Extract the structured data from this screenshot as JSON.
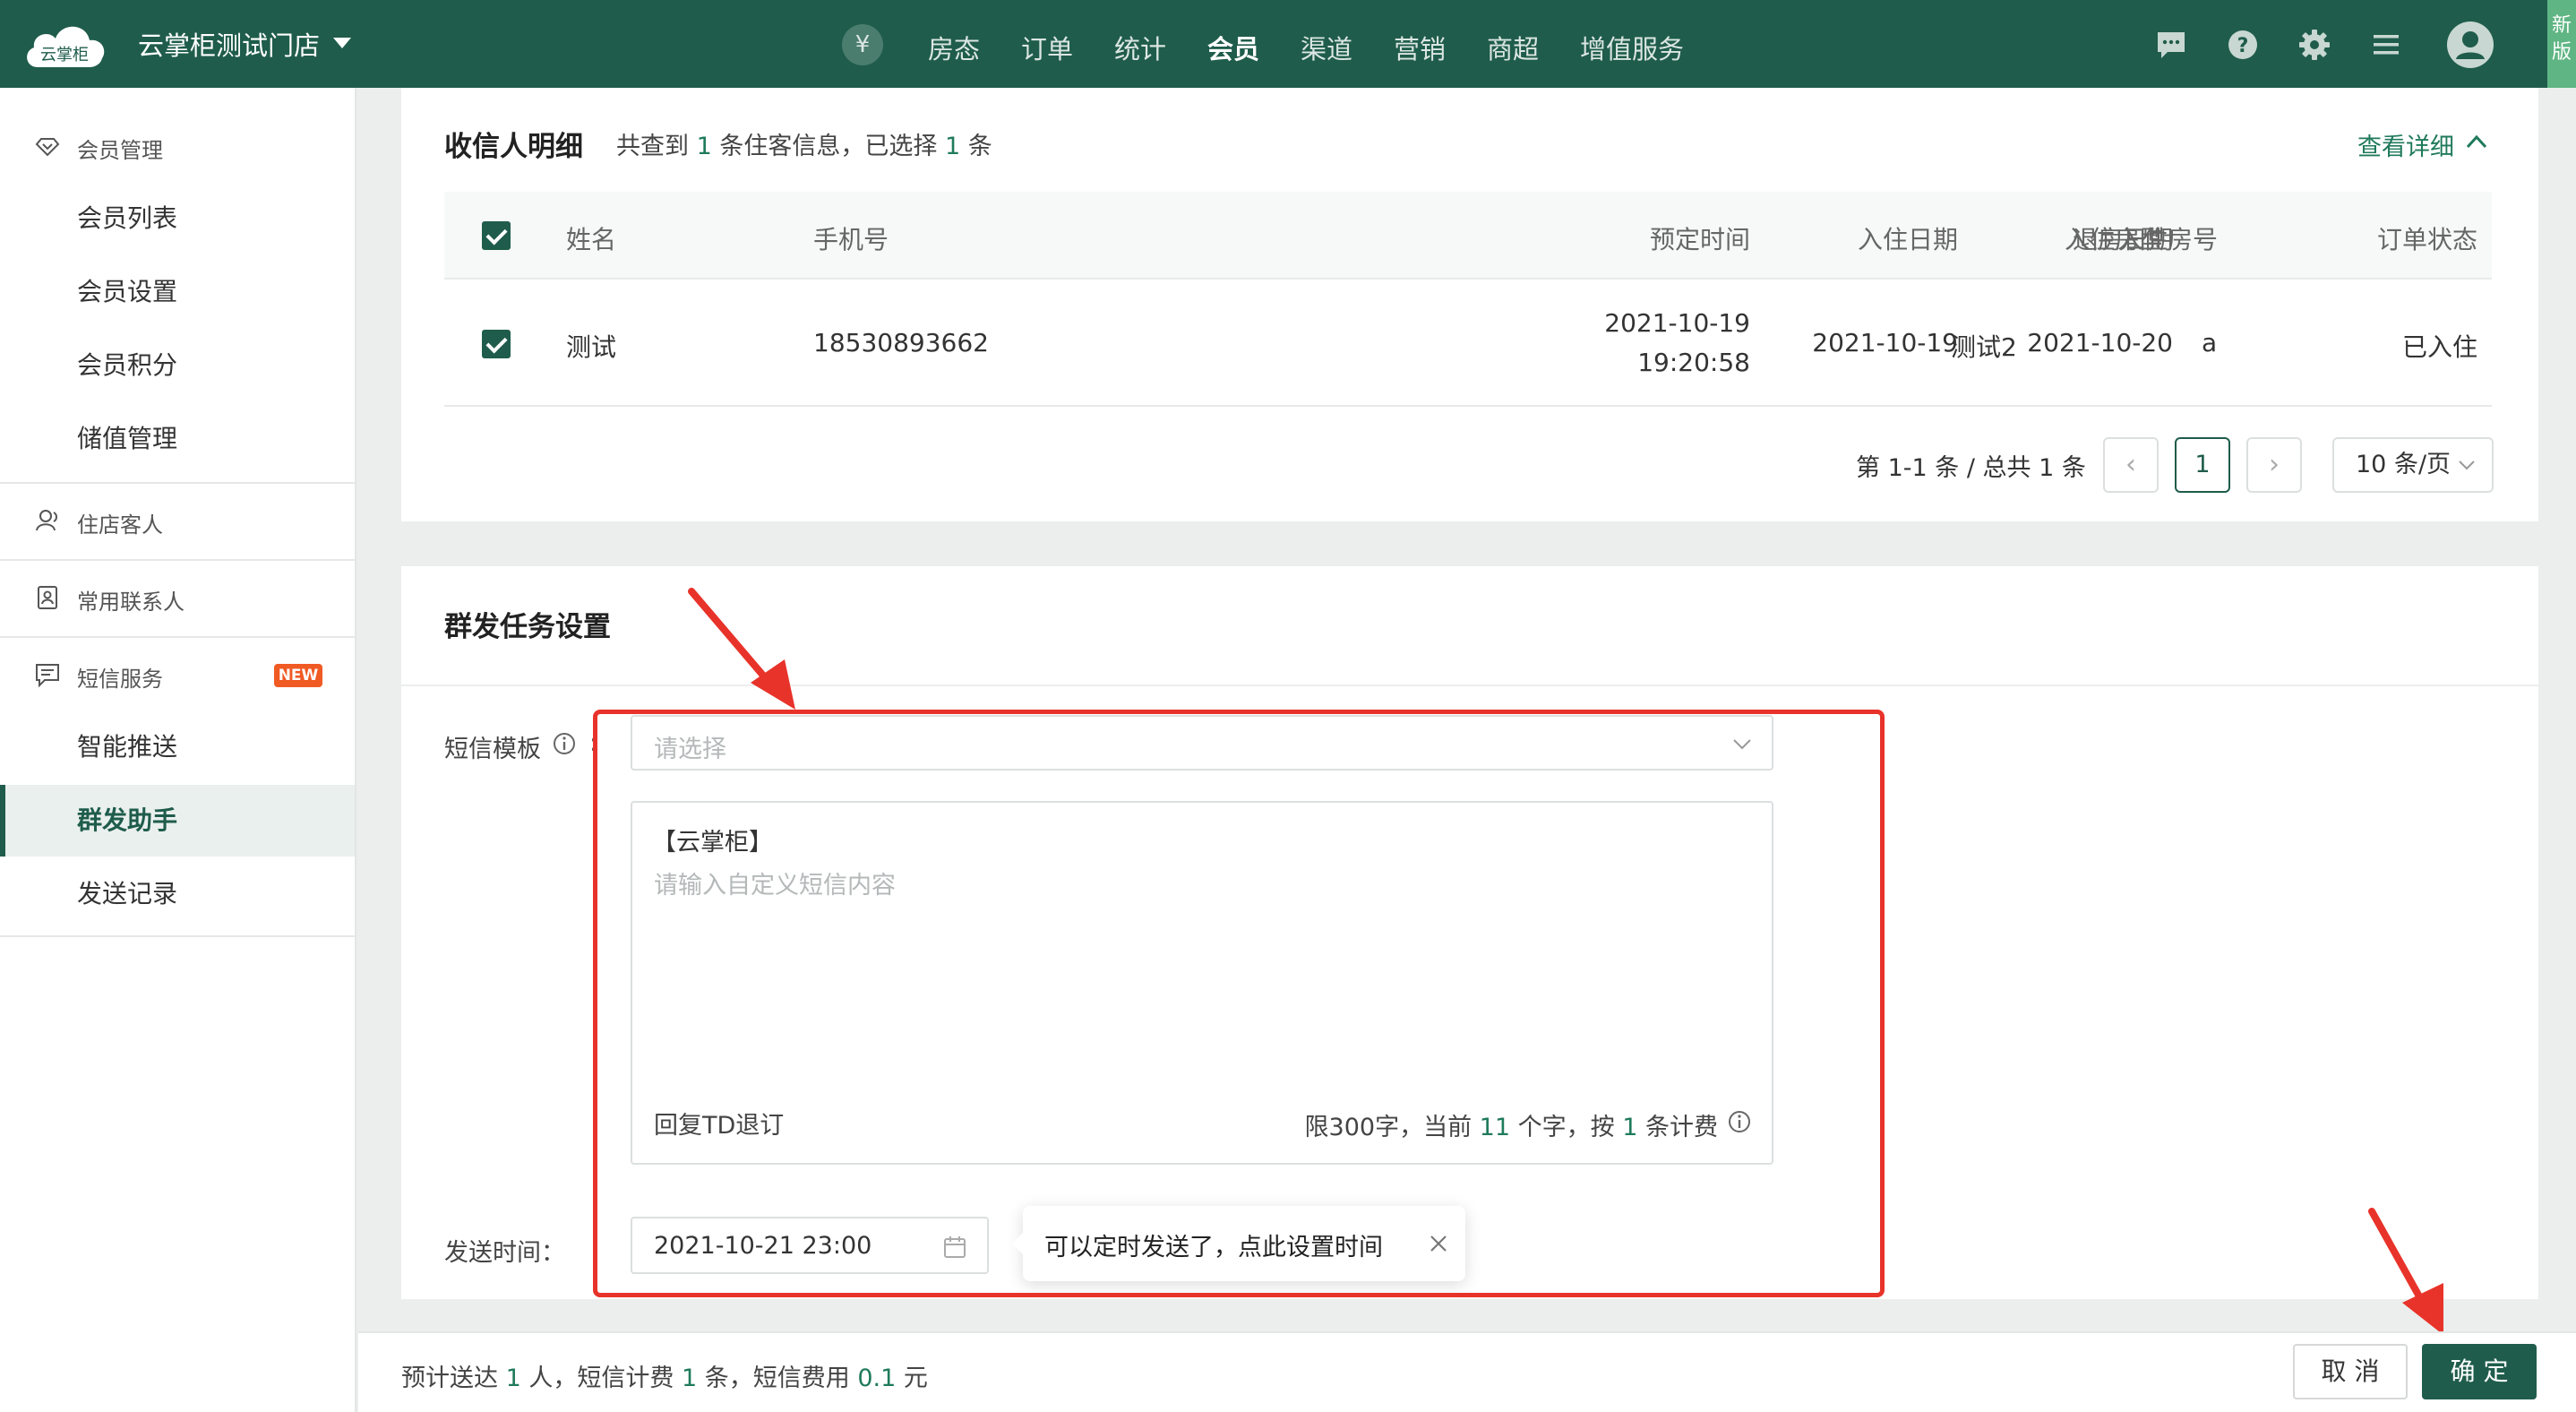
{
  "header": {
    "logo_text": "云掌柜",
    "store_name": "云掌柜测试门店",
    "yen_symbol": "¥",
    "nav": [
      "房态",
      "订单",
      "统计",
      "会员",
      "渠道",
      "营销",
      "商超",
      "增值服务"
    ],
    "active_nav": "会员",
    "new_version_tab": "新版",
    "icons": [
      "message-icon",
      "help-icon",
      "settings-gear-icon",
      "menu-icon",
      "user-avatar-icon"
    ]
  },
  "sidebar": {
    "member_mgmt": {
      "label": "会员管理",
      "items": [
        "会员列表",
        "会员设置",
        "会员积分",
        "储值管理"
      ]
    },
    "guests": "住店客人",
    "contacts": "常用联系人",
    "sms": {
      "label": "短信服务",
      "badge": "NEW",
      "items": [
        "智能推送",
        "群发助手",
        "发送记录"
      ],
      "active": "群发助手"
    }
  },
  "recipients": {
    "title": "收信人明细",
    "summary_prefix": "共查到",
    "total_count": "1",
    "summary_mid": "条住客信息，已选择",
    "selected_count": "1",
    "summary_suffix": "条",
    "detail_link": "查看详细",
    "columns": [
      "姓名",
      "手机号",
      "预定时间",
      "入住日期",
      "退房日期",
      "入住房型",
      "入住房号",
      "订单状态"
    ],
    "rows": [
      {
        "name": "测试",
        "phone": "18530893662",
        "booking_date": "2021-10-19",
        "booking_time": "19:20:58",
        "checkin": "2021-10-19",
        "checkout": "2021-10-20",
        "room_type": "测试2",
        "room_no": "a",
        "status": "已入住"
      }
    ],
    "pagination": {
      "range_text": "第 1-1 条 / 总共 1 条",
      "current_page": "1",
      "page_size": "10 条/页"
    }
  },
  "task": {
    "title": "群发任务设置",
    "template_label": "短信模板",
    "template_placeholder": "请选择",
    "sms_signature": "【云掌柜】",
    "content_placeholder": "请输入自定义短信内容",
    "unsubscribe_text": "回复TD退订",
    "limit_prefix": "限300字，当前",
    "char_count": "11",
    "limit_mid": "个字，按",
    "billing_count": "1",
    "limit_suffix": "条计费",
    "send_time_label": "发送时间：",
    "send_time_value": "2021-10-21 23:00",
    "tooltip_text": "可以定时发送了，点此设置时间"
  },
  "footer": {
    "estimate_prefix": "预计送达",
    "recipients_count": "1",
    "estimate_mid1": "人，短信计费",
    "billing_count": "1",
    "estimate_mid2": "条，短信费用",
    "cost": "0.1",
    "estimate_suffix": "元",
    "cancel_label": "取 消",
    "ok_label": "确 定"
  },
  "colors": {
    "brand": "#1f5c4b",
    "accent_green": "#1f7a5c",
    "highlight_red": "#e8332a",
    "badge_orange": "#f05a23"
  }
}
